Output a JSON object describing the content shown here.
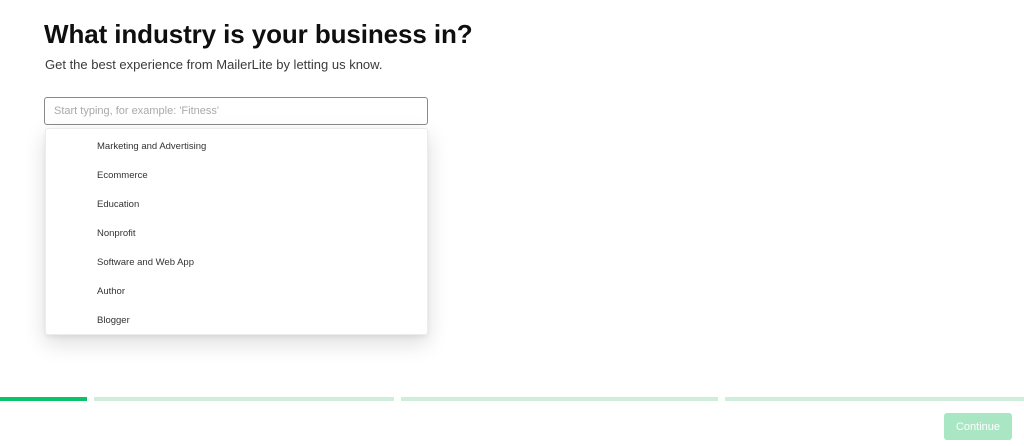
{
  "header": {
    "title": "What industry is your business in?",
    "subtitle": "Get the best experience from MailerLite by letting us know."
  },
  "search": {
    "value": "",
    "placeholder": "Start typing, for example: 'Fitness'"
  },
  "industry_options": [
    "Marketing and Advertising",
    "Ecommerce",
    "Education",
    "Nonprofit",
    "Software and Web App",
    "Author",
    "Blogger"
  ],
  "progress": {
    "steps": 4,
    "current_step": 1,
    "current_step_fill_fraction": 0.22,
    "active_color": "#09c269",
    "inactive_color": "#cdeedb"
  },
  "footer": {
    "continue_label": "Continue",
    "continue_disabled": true,
    "continue_color": "#a9e6c4"
  }
}
